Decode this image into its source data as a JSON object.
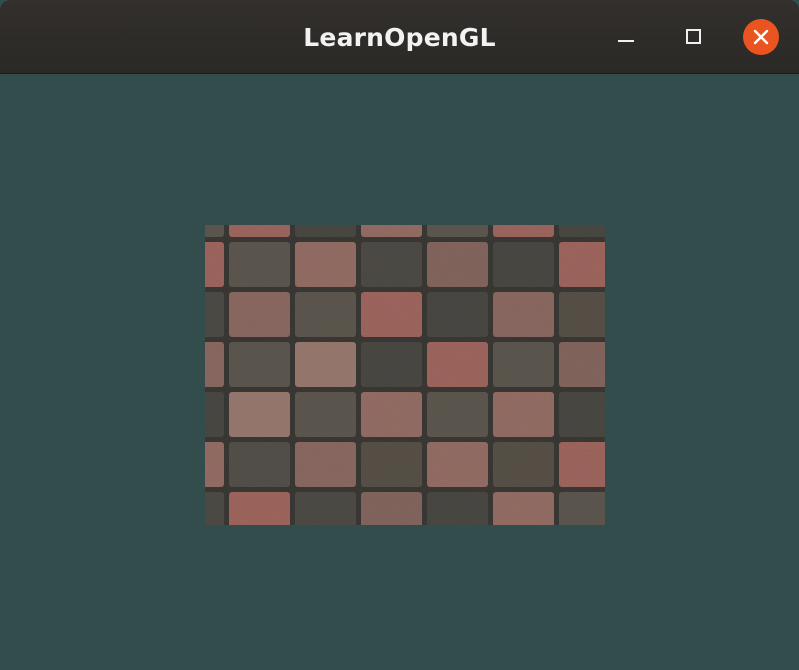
{
  "window": {
    "title": "LearnOpenGL",
    "clear_color": "#334d4d"
  },
  "titlebar": {
    "background": "#2e2c29",
    "buttons": {
      "minimize_icon": "minimize-icon",
      "maximize_icon": "maximize-icon",
      "close_icon": "close-icon",
      "close_color": "#e95420"
    }
  },
  "scene": {
    "object": "textured-quad",
    "texture": "brick-paver-checkerboard",
    "tile_colors": [
      "#4c4a45",
      "#8e6b63",
      "#5c5650",
      "#a36e66",
      "#6a5850"
    ]
  }
}
